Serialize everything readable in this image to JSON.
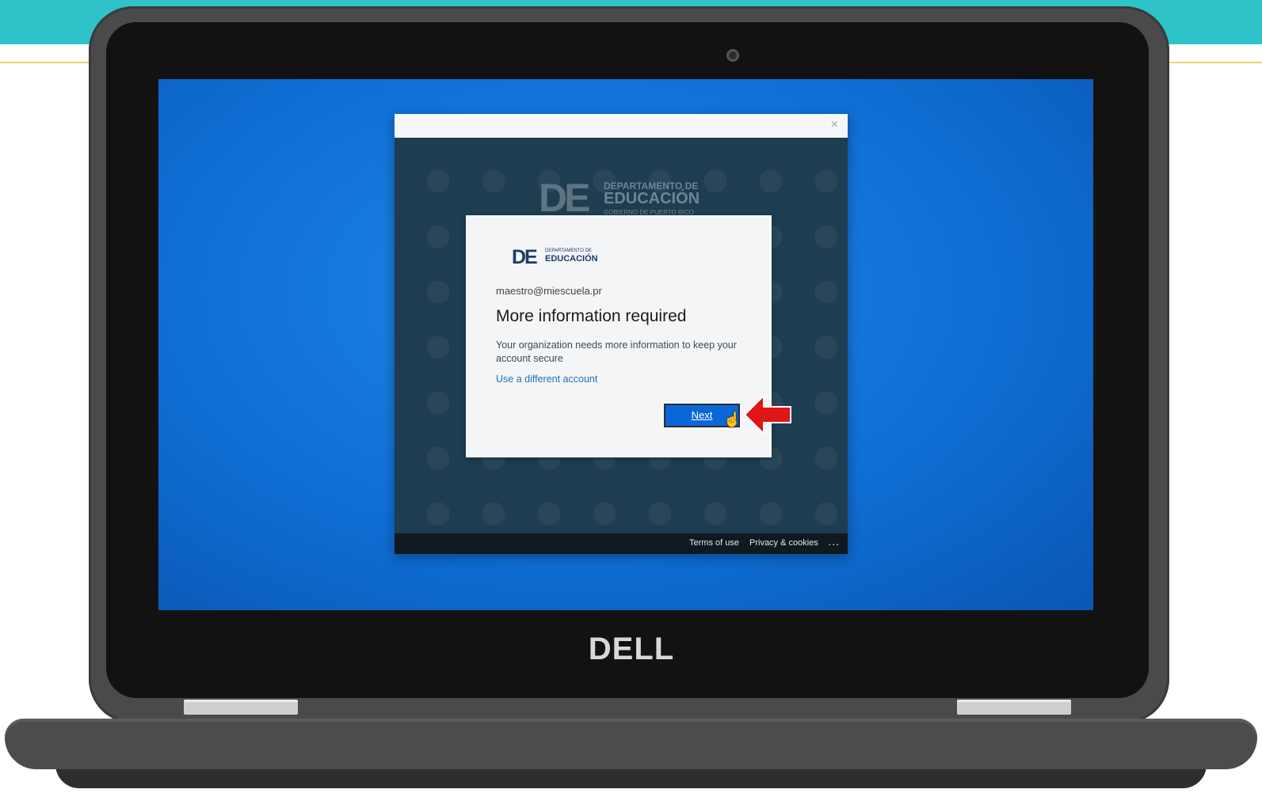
{
  "window": {
    "close_glyph": "×",
    "background_logo": {
      "mark": "DE",
      "line1": "DEPARTAMENTO DE",
      "line2": "EDUCACIÓN",
      "line3": "GOBIERNO DE PUERTO RICO"
    }
  },
  "dialog": {
    "logo": {
      "mark": "DE",
      "line1": "DEPARTAMENTO DE",
      "line2": "EDUCACIÓN"
    },
    "email": "maestro@miescuela.pr",
    "title": "More information required",
    "body": "Your organization needs more information to keep your account secure",
    "link": "Use a different account",
    "next_button": "Next"
  },
  "footer": {
    "terms": "Terms of use",
    "privacy": "Privacy & cookies",
    "more": "..."
  },
  "laptop": {
    "brand": "DELL"
  },
  "colors": {
    "accent_band": "#2dc3c8",
    "desktop": "#0f6fd6",
    "next_button": "#0b67d8",
    "arrow": "#e01515"
  },
  "icons": [
    "close-icon",
    "cursor-hand-icon",
    "red-arrow-icon",
    "camera-icon"
  ]
}
